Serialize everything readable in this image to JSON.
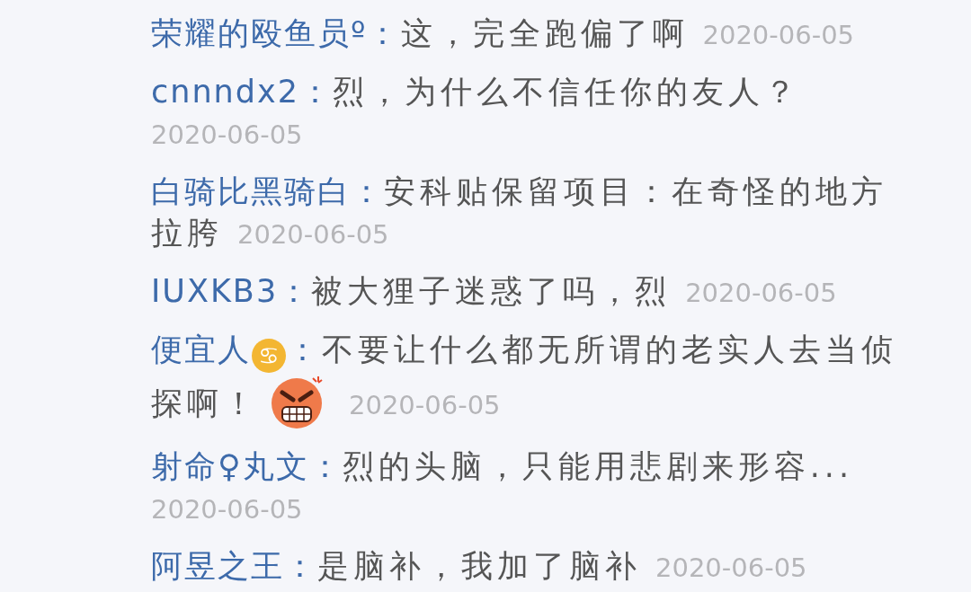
{
  "comments": [
    {
      "author": "荣耀的殴鱼员º：",
      "text": "这，完全跑偏了啊",
      "date": "2020-06-05"
    },
    {
      "author": "cnnndx2：",
      "text": "烈，为什么不信任你的友人？",
      "date": "2020-06-05"
    },
    {
      "author": "白骑比黑骑白：",
      "text": "安科贴保留项目：在奇怪的地方拉胯",
      "date": "2020-06-05"
    },
    {
      "author": "IUXKB3：",
      "text": "被大狸子迷惑了吗，烈",
      "date": "2020-06-05"
    },
    {
      "author": "便宜人",
      "author_badge": "♋",
      "author_suffix": "：",
      "text": "不要让什么都无所谓的老实人去当侦探啊！",
      "angry_emoji": true,
      "date": "2020-06-05"
    },
    {
      "author": "射命♀丸文：",
      "text": "烈的头脑，只能用悲剧来形容...",
      "date": "2020-06-05"
    },
    {
      "author": "阿昱之王：",
      "text": "是脑补，我加了脑补",
      "date": "2020-06-05"
    }
  ]
}
